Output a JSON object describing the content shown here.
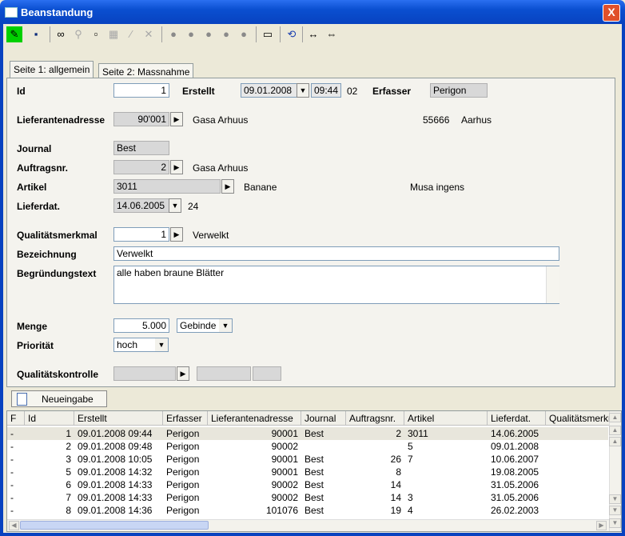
{
  "window": {
    "title": "Beanstandung",
    "close_label": "X"
  },
  "toolbar": {
    "items": [
      {
        "name": "edit-pencil-icon",
        "glyph": "✎"
      },
      {
        "name": "save-icon",
        "glyph": "▪"
      },
      {
        "name": "binoculars-icon",
        "glyph": "∞"
      },
      {
        "name": "search-zoom-icon",
        "glyph": "⚲"
      },
      {
        "name": "new-document-icon",
        "glyph": "▫"
      },
      {
        "name": "print-icon",
        "glyph": "▦"
      },
      {
        "name": "brush-icon",
        "glyph": "⁄"
      },
      {
        "name": "delete-x-icon",
        "glyph": "✕"
      },
      {
        "name": "ball-first-icon",
        "glyph": "●"
      },
      {
        "name": "ball-prev-icon",
        "glyph": "●"
      },
      {
        "name": "ball-next-icon",
        "glyph": "●"
      },
      {
        "name": "ball-last-icon",
        "glyph": "●"
      },
      {
        "name": "ball-end-icon",
        "glyph": "●"
      },
      {
        "name": "minimize-form-icon",
        "glyph": "▭"
      },
      {
        "name": "refresh-icon",
        "glyph": "⟲"
      },
      {
        "name": "fit-width-icon",
        "glyph": "↔"
      },
      {
        "name": "fit-page-icon",
        "glyph": "⇔"
      }
    ]
  },
  "tabs": {
    "tab1": "Seite 1: allgemein",
    "tab2": "Seite 2: Massnahme"
  },
  "form": {
    "id_label": "Id",
    "id_value": "1",
    "erstellt_label": "Erstellt",
    "erstellt_date": "09.01.2008",
    "erstellt_time": "09:44",
    "erstellt_num": "02",
    "erfasser_label": "Erfasser",
    "erfasser_value": "Perigon",
    "lieferant_label": "Lieferantenadresse",
    "lieferant_value": "90'001",
    "lieferant_name": "Gasa Arhuus",
    "lieferant_plz": "55666",
    "lieferant_ort": "Aarhus",
    "journal_label": "Journal",
    "journal_value": "Best",
    "auftrag_label": "Auftragsnr.",
    "auftrag_value": "2",
    "auftrag_name": "Gasa Arhuus",
    "artikel_label": "Artikel",
    "artikel_value": "3011",
    "artikel_name": "Banane",
    "artikel_latin": "Musa ingens",
    "lieferdat_label": "Lieferdat.",
    "lieferdat_value": "14.06.2005",
    "lieferdat_extra": "24",
    "qm_label": "Qualitätsmerkmal",
    "qm_value": "1",
    "qm_text": "Verwelkt",
    "bez_label": "Bezeichnung",
    "bez_value": "Verwelkt",
    "begr_label": "Begründungstext",
    "begr_value": "alle haben braune Blätter",
    "menge_label": "Menge",
    "menge_value": "5.000",
    "menge_unit": "Gebinde",
    "prio_label": "Priorität",
    "prio_value": "hoch",
    "qk_label": "Qualitätskontrolle"
  },
  "new_button": {
    "label": "Neueingabe"
  },
  "grid": {
    "headers": [
      "F",
      "Id",
      "Erstellt",
      "Erfasser",
      "Lieferantenadresse",
      "Journal",
      "Auftragsnr.",
      "Artikel",
      "Lieferdat.",
      "Qualitätsmerkmal"
    ],
    "rows": [
      [
        "-",
        "1",
        "09.01.2008 09:44",
        "Perigon",
        "90001",
        "Best",
        "2",
        "3011",
        "14.06.2005",
        ""
      ],
      [
        "-",
        "2",
        "09.01.2008 09:48",
        "Perigon",
        "90002",
        "",
        "",
        "5",
        "09.01.2008",
        ""
      ],
      [
        "-",
        "3",
        "09.01.2008 10:05",
        "Perigon",
        "90001",
        "Best",
        "26",
        "7",
        "10.06.2007",
        ""
      ],
      [
        "-",
        "5",
        "09.01.2008 14:32",
        "Perigon",
        "90001",
        "Best",
        "8",
        "",
        "19.08.2005",
        ""
      ],
      [
        "-",
        "6",
        "09.01.2008 14:33",
        "Perigon",
        "90002",
        "Best",
        "14",
        "",
        "31.05.2006",
        ""
      ],
      [
        "-",
        "7",
        "09.01.2008 14:33",
        "Perigon",
        "90002",
        "Best",
        "14",
        "3",
        "31.05.2006",
        ""
      ],
      [
        "-",
        "8",
        "09.01.2008 14:36",
        "Perigon",
        "101076",
        "Best",
        "19",
        "4",
        "26.02.2003",
        ""
      ]
    ]
  },
  "colors": {
    "titlebar": "#0a4fd0",
    "selected_row": "#e8e6dc",
    "edit_icon_bg": "#00d000"
  }
}
